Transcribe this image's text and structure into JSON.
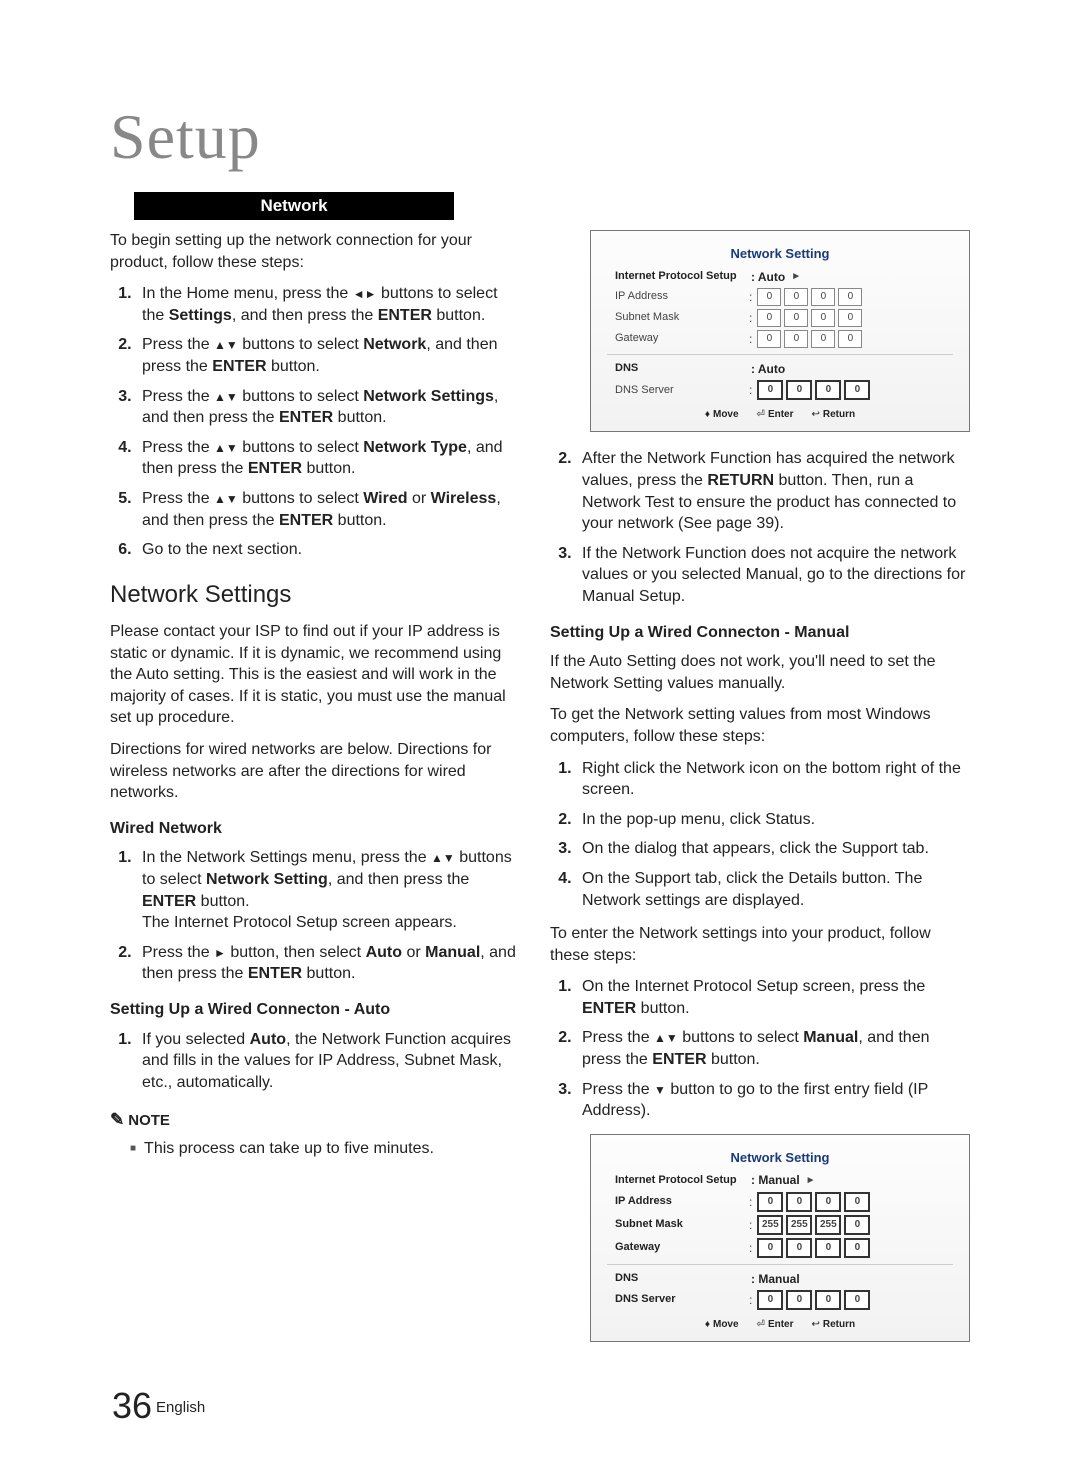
{
  "title": "Setup",
  "section": "Network",
  "intro": "To begin setting up the network connection for your product, follow these steps:",
  "steps_main": [
    {
      "pre": "In the Home menu, press the ",
      "btn1": "◄►",
      "mid": " buttons to select the ",
      "bold1": "Settings",
      "post": ", and then press the ",
      "bold2": "ENTER",
      "tail": " button."
    },
    {
      "pre": "Press the ",
      "btn1": "▲▼",
      "mid": " buttons to select ",
      "bold1": "Network",
      "post": ", and then press the ",
      "bold2": "ENTER",
      "tail": " button."
    },
    {
      "pre": "Press the ",
      "btn1": "▲▼",
      "mid": " buttons to select ",
      "bold1": "Network Settings",
      "post": ", and then press the ",
      "bold2": "ENTER",
      "tail": " button."
    },
    {
      "pre": "Press the ",
      "btn1": "▲▼",
      "mid": " buttons to select ",
      "bold1": "Network Type",
      "post": ", and then press the ",
      "bold2": "ENTER",
      "tail": " button."
    },
    {
      "pre": "Press the ",
      "btn1": "▲▼",
      "mid": " buttons to select ",
      "bold1": "Wired",
      "mid2": " or ",
      "bold1b": "Wireless",
      "post": ", and then press the ",
      "bold2": "ENTER",
      "tail": " button."
    },
    {
      "plain": "Go to the next section."
    }
  ],
  "h2": "Network Settings",
  "para1": "Please contact your ISP to find out if your IP address is static or dynamic. If it is dynamic, we recommend using the Auto setting. This is the easiest and will work in the majority of cases. If it is static, you must use the manual set up procedure.",
  "para2": "Directions for wired networks are below. Directions for wireless networks are after the directions for wired networks.",
  "wired_head": "Wired Network",
  "wired_steps": [
    {
      "pre": "In the Network Settings menu, press the ",
      "btn1": "▲▼",
      "mid": " buttons to select ",
      "bold1": "Network Setting",
      "post": ", and then press the ",
      "bold2": "ENTER",
      "tail": " button.",
      "after": "The Internet Protocol Setup screen appears."
    },
    {
      "pre": "Press the ",
      "btn1": "►",
      "mid": " button, then select ",
      "bold1": "Auto",
      "mid2": " or ",
      "bold1b": "Manual",
      "post": ", and then press the ",
      "bold2": "ENTER",
      "tail": " button."
    }
  ],
  "auto_head": "Setting Up a Wired Connecton - Auto",
  "auto_step": {
    "pre": "If you selected ",
    "bold1": "Auto",
    "post": ", the Network Function acquires and fills in the values for IP Address, Subnet Mask, etc., automatically."
  },
  "note_label": "NOTE",
  "note_text": "This process can take up to five minutes.",
  "osd1": {
    "title": "Network Setting",
    "rows": {
      "ips": {
        "label": "Internet Protocol Setup",
        "mode": ": Auto"
      },
      "ip": {
        "label": "IP Address",
        "v": [
          "0",
          "0",
          "0",
          "0"
        ]
      },
      "sm": {
        "label": "Subnet Mask",
        "v": [
          "0",
          "0",
          "0",
          "0"
        ]
      },
      "gw": {
        "label": "Gateway",
        "v": [
          "0",
          "0",
          "0",
          "0"
        ]
      },
      "dns": {
        "label": "DNS",
        "mode": ": Auto"
      },
      "srv": {
        "label": "DNS Server",
        "v": [
          "0",
          "0",
          "0",
          "0"
        ]
      }
    },
    "footer": {
      "move": "Move",
      "enter": "Enter",
      "return": "Return"
    }
  },
  "right_steps_cont": [
    {
      "pre": "After the Network Function has acquired the network values, press the ",
      "bold1": "RETURN",
      "post": " button. Then, run a Network Test to ensure the product has connected to your network (See page 39)."
    },
    {
      "plain": "If the Network Function does not acquire the network values or you selected Manual, go to the directions for Manual Setup."
    }
  ],
  "manual_head": "Setting Up a Wired Connecton - Manual",
  "manual_para1": "If the Auto Setting does not work, you'll need to set the Network Setting values manually.",
  "manual_para2": "To get the Network setting values from most Windows computers, follow these steps:",
  "manual_winsteps": [
    "Right click the Network icon on the bottom right of the screen.",
    "In the pop-up menu, click Status.",
    "On the dialog that appears, click the Support tab.",
    "On the Support tab, click the Details button. The Network settings are displayed."
  ],
  "manual_para3": "To enter the Network settings into your product, follow these steps:",
  "manual_prodsteps": [
    {
      "pre": "On the Internet Protocol Setup screen, press the ",
      "bold1": "ENTER",
      "tail": " button."
    },
    {
      "pre": "Press the ",
      "btn1": "▲▼",
      "mid": " buttons to select ",
      "bold1": "Manual",
      "post": ", and then press the ",
      "bold2": "ENTER",
      "tail": " button."
    },
    {
      "pre": "Press the ",
      "btn1": "▼",
      "mid": " button to go to the first entry field (IP Address)."
    }
  ],
  "osd2": {
    "title": "Network Setting",
    "rows": {
      "ips": {
        "label": "Internet Protocol Setup",
        "mode": ": Manual"
      },
      "ip": {
        "label": "IP Address",
        "v": [
          "0",
          "0",
          "0",
          "0"
        ]
      },
      "sm": {
        "label": "Subnet Mask",
        "v": [
          "255",
          "255",
          "255",
          "0"
        ]
      },
      "gw": {
        "label": "Gateway",
        "v": [
          "0",
          "0",
          "0",
          "0"
        ]
      },
      "dns": {
        "label": "DNS",
        "mode": ": Manual"
      },
      "srv": {
        "label": "DNS Server",
        "v": [
          "0",
          "0",
          "0",
          "0"
        ]
      }
    },
    "footer": {
      "move": "Move",
      "enter": "Enter",
      "return": "Return"
    }
  },
  "page_number": "36",
  "page_lang": "English"
}
